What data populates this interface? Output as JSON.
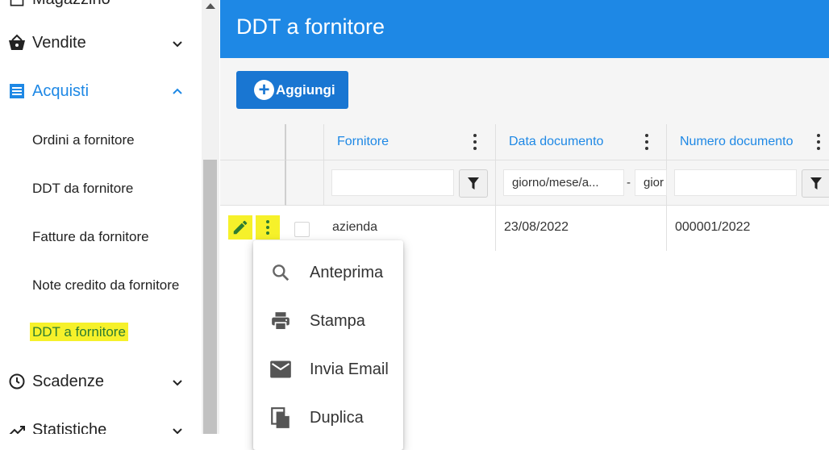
{
  "sidebar": {
    "top_cut_label": "Magazzino",
    "groups": [
      {
        "label": "Vendite",
        "icon": "basket-icon",
        "expanded": false
      },
      {
        "label": "Acquisti",
        "icon": "list-icon",
        "expanded": true
      },
      {
        "label": "Scadenze",
        "icon": "clock-icon",
        "expanded": false
      },
      {
        "label": "Statistiche",
        "icon": "trending-icon",
        "expanded": false
      }
    ],
    "acquisti_items": [
      {
        "label": "Ordini a fornitore"
      },
      {
        "label": "DDT da fornitore"
      },
      {
        "label": "Fatture da fornitore"
      },
      {
        "label": "Note credito da fornitore"
      },
      {
        "label": "DDT a fornitore",
        "selected": true
      }
    ]
  },
  "header": {
    "title": "DDT a fornitore"
  },
  "toolbar": {
    "add_label": "Aggiungi"
  },
  "grid": {
    "columns": [
      {
        "label": "Fornitore"
      },
      {
        "label": "Data documento"
      },
      {
        "label": "Numero documento"
      }
    ],
    "filters": {
      "fornitore": "",
      "data_from_placeholder": "giorno/mese/a...",
      "data_separator": "-",
      "data_to_placeholder": "gior",
      "numero": ""
    },
    "rows": [
      {
        "fornitore": "azienda",
        "data_documento": "23/08/2022",
        "numero_documento": "000001/2022"
      }
    ]
  },
  "context_menu": {
    "items": [
      {
        "label": "Anteprima",
        "icon": "search-icon"
      },
      {
        "label": "Stampa",
        "icon": "print-icon"
      },
      {
        "label": "Invia Email",
        "icon": "email-icon"
      },
      {
        "label": "Duplica",
        "icon": "copy-icon"
      }
    ]
  },
  "colors": {
    "primary": "#1e88e5",
    "button": "#1976d2",
    "highlight": "#f6f12a",
    "action_green": "#2e7d32"
  }
}
